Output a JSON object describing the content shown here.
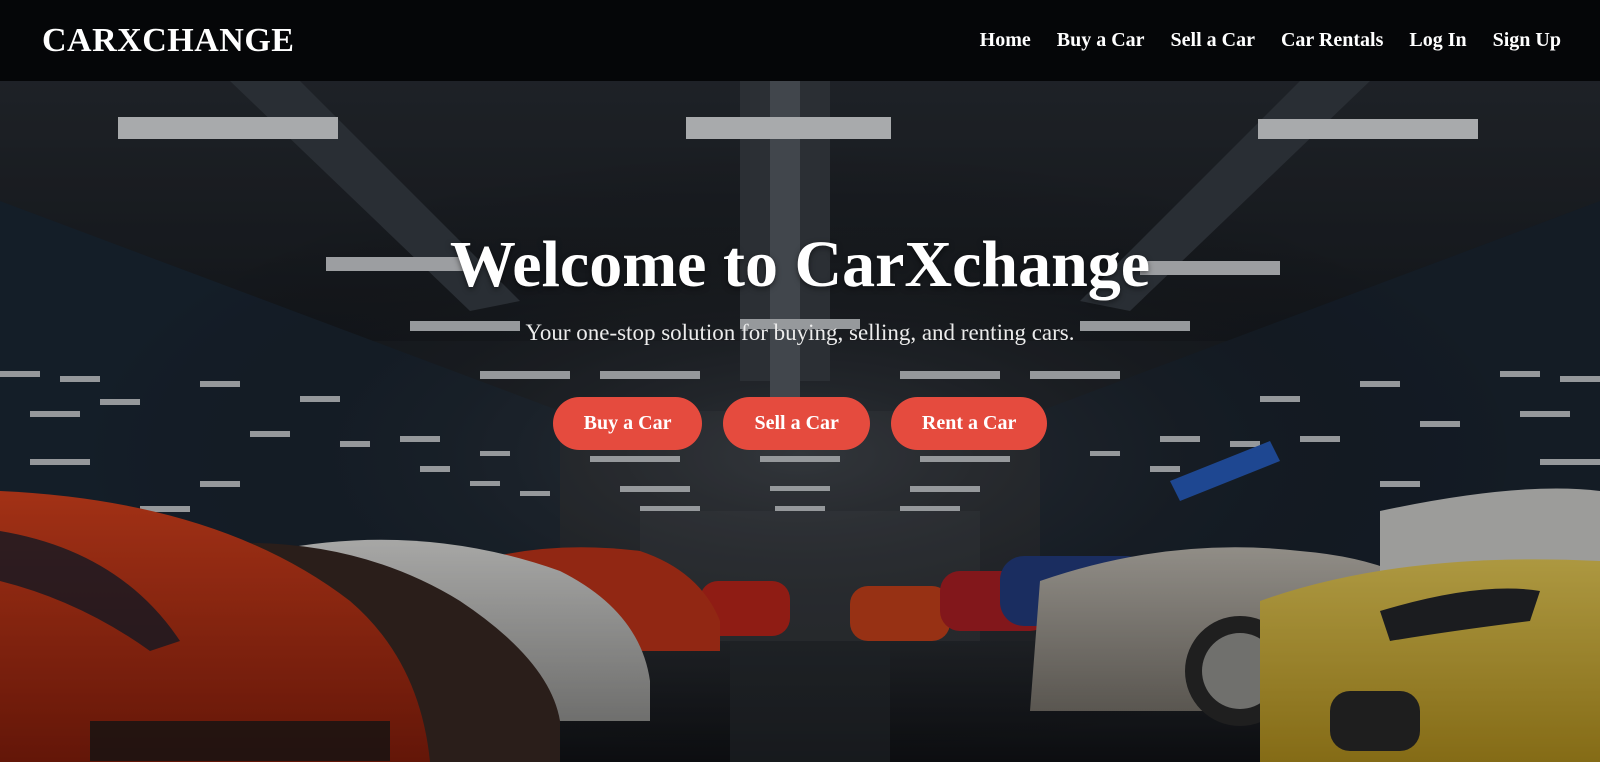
{
  "header": {
    "brand": "CARXCHANGE",
    "nav": [
      {
        "label": "Home"
      },
      {
        "label": "Buy a Car"
      },
      {
        "label": "Sell a Car"
      },
      {
        "label": "Car Rentals"
      },
      {
        "label": "Log In"
      },
      {
        "label": "Sign Up"
      }
    ]
  },
  "hero": {
    "title": "Welcome to CarXchange",
    "subtitle": "Your one-stop solution for buying, selling, and renting cars.",
    "buttons": [
      {
        "label": "Buy a Car"
      },
      {
        "label": "Sell a Car"
      },
      {
        "label": "Rent a Car"
      }
    ],
    "background_image": "garage-supercars-photo"
  },
  "colors": {
    "navbar_bg": "#050608",
    "cta_bg": "#e54b3e",
    "text": "#ffffff"
  }
}
